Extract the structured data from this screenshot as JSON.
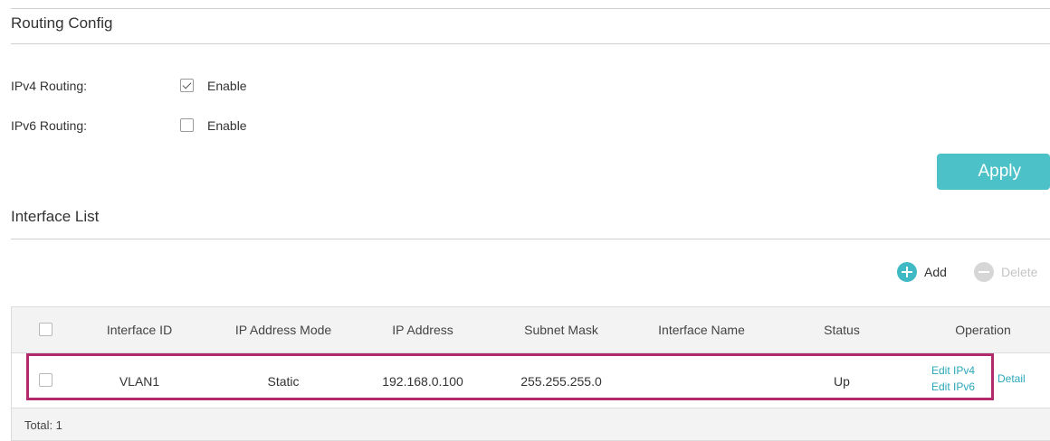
{
  "routing_config": {
    "title": "Routing Config",
    "ipv4": {
      "label": "IPv4 Routing:",
      "checkbox_text": "Enable",
      "checked": true
    },
    "ipv6": {
      "label": "IPv6 Routing:",
      "checkbox_text": "Enable",
      "checked": false
    },
    "apply_label": "Apply"
  },
  "interface_list": {
    "title": "Interface List",
    "toolbar": {
      "add_label": "Add",
      "delete_label": "Delete",
      "add_icon": "plus-circle-icon",
      "delete_icon": "minus-circle-icon"
    },
    "columns": [
      "Interface ID",
      "IP Address Mode",
      "IP Address",
      "Subnet Mask",
      "Interface Name",
      "Status",
      "Operation"
    ],
    "rows": [
      {
        "interface_id": "VLAN1",
        "ip_address_mode": "Static",
        "ip_address": "192.168.0.100",
        "subnet_mask": "255.255.255.0",
        "interface_name": "",
        "status": "Up",
        "operations": {
          "edit_ipv4": "Edit IPv4",
          "edit_ipv6": "Edit IPv6",
          "detail": "Detail"
        }
      }
    ],
    "total_label": "Total: 1"
  },
  "colors": {
    "accent": "#4cc1c7",
    "link": "#2aa7b8",
    "highlight": "#b12a6c",
    "header_bg": "#f3f3f3"
  }
}
